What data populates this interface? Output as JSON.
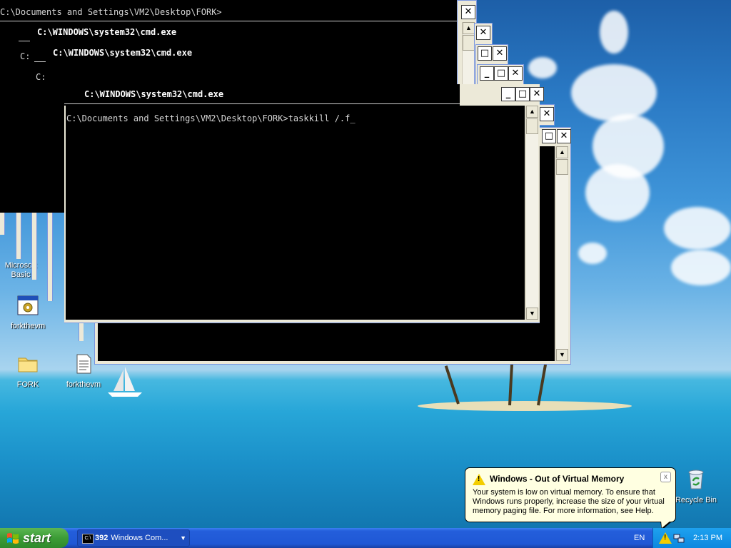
{
  "desktop": {
    "icons": [
      {
        "label": "Microsoft\nBasic"
      },
      {
        "label": "forkthevm"
      },
      {
        "label": "FORK"
      },
      {
        "label": "forkthevm"
      },
      {
        "label": "Recycle Bin"
      }
    ]
  },
  "windows": {
    "top_prompt": "C:\\Documents and Settings\\VM2\\Desktop\\FORK>",
    "title_1": "C:\\WINDOWS\\system32\\cmd.exe",
    "title_2": "C:\\WINDOWS\\system32\\cmd.exe",
    "title_3": "C:\\WINDOWS\\system32\\cmd.exe",
    "stray_1": "C:",
    "stray_2": "C:",
    "active_prompt": "C:\\Documents and Settings\\VM2\\Desktop\\FORK>",
    "active_command": "taskkill /.f",
    "cursor": "_",
    "close_glyph": "✕",
    "max_glyph": "□",
    "min_glyph": "_"
  },
  "balloon": {
    "title": "Windows - Out of Virtual Memory",
    "text": "Your system is low on virtual memory. To ensure that Windows runs properly, increase the size of your virtual memory paging file. For more information, see Help.",
    "close": "x"
  },
  "taskbar": {
    "start_label": "start",
    "task_count": "392",
    "task_label": "Windows Com...",
    "task_icon": "C:\\",
    "language": "EN",
    "clock": "2:13 PM"
  },
  "colors": {
    "balloon_bg": "#ffffe1",
    "taskbar": "#245edb",
    "start": "#3c9c36"
  }
}
